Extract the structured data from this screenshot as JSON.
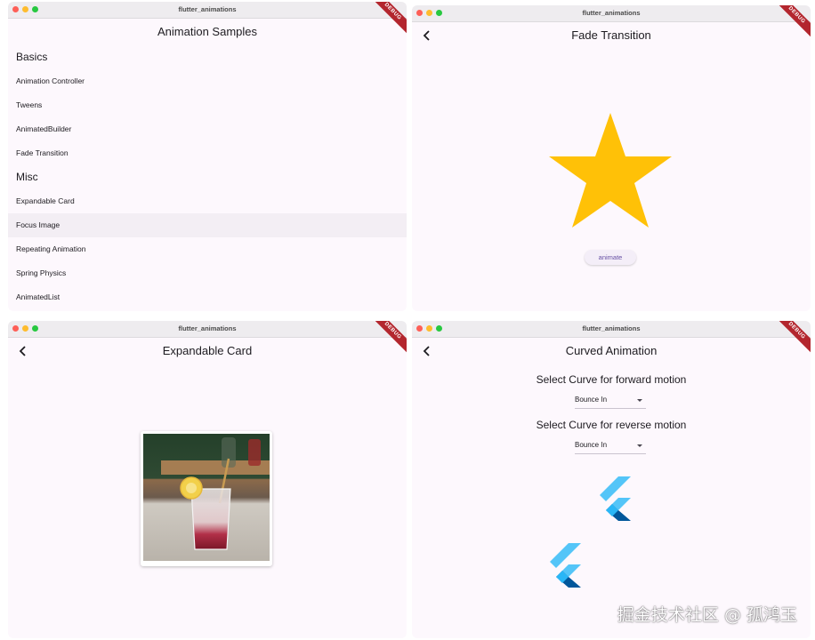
{
  "windows": {
    "list": {
      "title": "flutter_animations",
      "appbar_title": "Animation Samples",
      "debug": "DEBUG",
      "sections": [
        {
          "label": "Basics",
          "items": [
            "Animation Controller",
            "Tweens",
            "AnimatedBuilder",
            "Fade Transition"
          ]
        },
        {
          "label": "Misc",
          "items": [
            "Expandable Card",
            "Focus Image",
            "Repeating Animation",
            "Spring Physics",
            "AnimatedList"
          ]
        }
      ],
      "highlighted_item": "Focus Image"
    },
    "fade": {
      "title": "flutter_animations",
      "appbar_title": "Fade Transition",
      "debug": "DEBUG",
      "button_label": "animate",
      "star_color": "#ffc107"
    },
    "card": {
      "title": "flutter_animations",
      "appbar_title": "Expandable Card",
      "debug": "DEBUG"
    },
    "curved": {
      "title": "flutter_animations",
      "appbar_title": "Curved Animation",
      "debug": "DEBUG",
      "forward_label": "Select Curve for forward motion",
      "forward_value": "Bounce In",
      "reverse_label": "Select Curve for reverse motion",
      "reverse_value": "Bounce In"
    }
  },
  "watermark": "掘金技术社区 @ 孤鸿玉",
  "colors": {
    "accent": "#6750a4",
    "debug_ribbon": "#b3262e",
    "flutter_light": "#54c5f8",
    "flutter_dark": "#01579b"
  }
}
